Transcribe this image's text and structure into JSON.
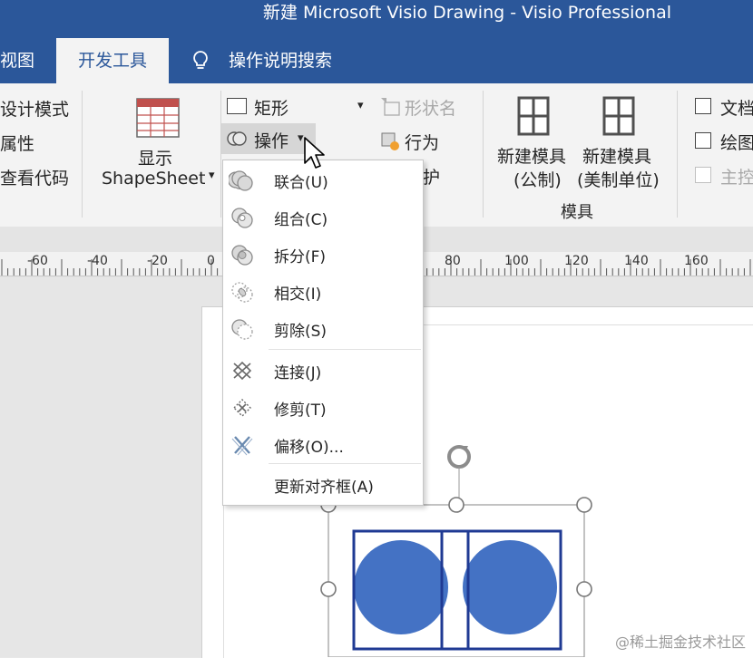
{
  "window": {
    "title": "新建 Microsoft Visio Drawing  -  Visio Professional"
  },
  "tabs": {
    "view": "视图",
    "developer": "开发工具",
    "tell_me": "操作说明搜索"
  },
  "ribbon": {
    "code_group": {
      "design_mode": "设计模式",
      "properties": "属性",
      "view_code": "查看代码"
    },
    "show_shapesheet": {
      "line1": "显示",
      "line2": "ShapeSheet"
    },
    "shape_design": {
      "rectangle": "矩形",
      "operations": "操作",
      "shape_name": "形状名",
      "behavior": "行为",
      "protection": "护"
    },
    "stencil": {
      "new_metric_line1": "新建模具",
      "new_metric_line2": "(公制)",
      "new_us_line1": "新建模具",
      "new_us_line2": "(美制单位)",
      "group_label": "模具"
    },
    "show_hide": {
      "doc": "文档",
      "drawing": "绘图",
      "master": "主控"
    }
  },
  "ruler": {
    "labels": [
      "-60",
      "-40",
      "-20",
      "0",
      "80",
      "100",
      "120",
      "140",
      "160"
    ]
  },
  "operations_menu": {
    "items": [
      {
        "label": "联合(U)",
        "icon": "union-icon"
      },
      {
        "label": "组合(C)",
        "icon": "combine-icon"
      },
      {
        "label": "拆分(F)",
        "icon": "fragment-icon"
      },
      {
        "label": "相交(I)",
        "icon": "intersect-icon"
      },
      {
        "label": "剪除(S)",
        "icon": "subtract-icon"
      },
      {
        "label": "连接(J)",
        "icon": "join-icon"
      },
      {
        "label": "修剪(T)",
        "icon": "trim-icon"
      },
      {
        "label": "偏移(O)...",
        "icon": "offset-icon"
      },
      {
        "label": "更新对齐框(A)",
        "icon": ""
      }
    ]
  },
  "colors": {
    "title_bar": "#2b579a",
    "shape_fill": "#4472c4",
    "shape_outline": "#1f3a93"
  },
  "watermark": "@稀土掘金技术社区"
}
